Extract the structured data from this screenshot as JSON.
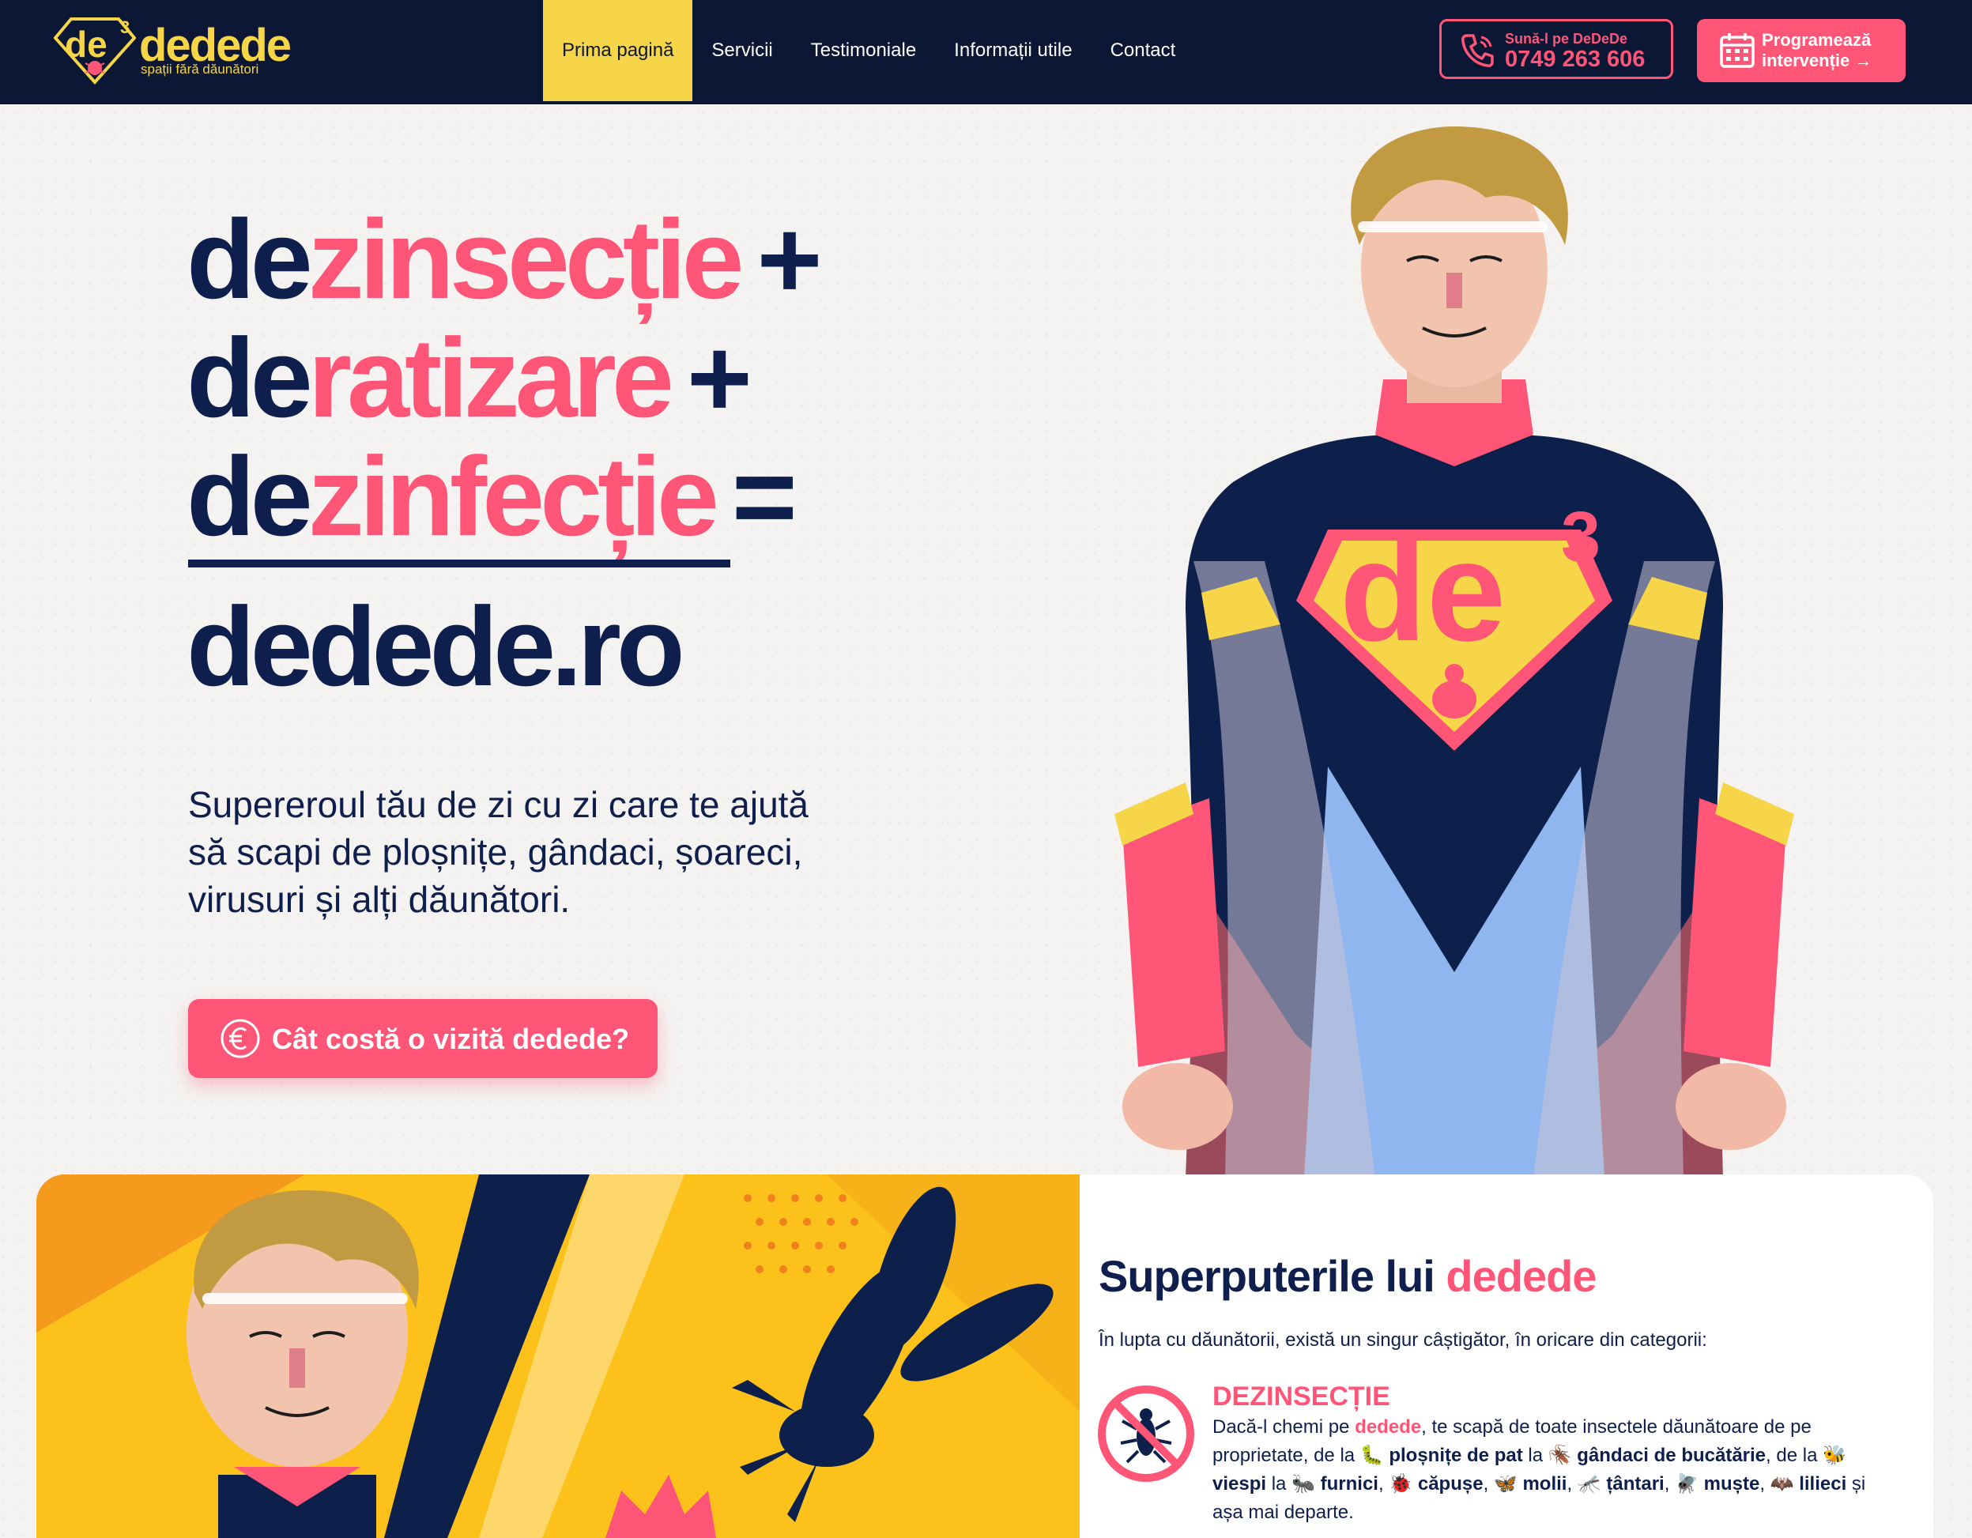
{
  "brand": {
    "logo_mark": "de",
    "logo_sup": "3",
    "name": "dedede",
    "tagline": "spații fără dăunători"
  },
  "nav": {
    "items": [
      {
        "label": "Prima pagină",
        "active": true
      },
      {
        "label": "Servicii",
        "active": false
      },
      {
        "label": "Testimoniale",
        "active": false
      },
      {
        "label": "Informații utile",
        "active": false
      },
      {
        "label": "Contact",
        "active": false
      }
    ]
  },
  "call": {
    "small": "Sună-l pe DeDeDe",
    "number": "0749 263 606",
    "icon": "phone-icon"
  },
  "book": {
    "line1": "Programează",
    "line2": "intervenție →",
    "icon": "calendar-icon"
  },
  "hero": {
    "lines": [
      {
        "prefix": "de",
        "word": "zinsecție",
        "op": "+"
      },
      {
        "prefix": "de",
        "word": "ratizare",
        "op": "+"
      },
      {
        "prefix": "de",
        "word": "zinfecție",
        "op": "="
      }
    ],
    "domain": "dedede.ro",
    "subtitle": "Supereroul tău de zi cu zi care te ajută să scapi de ploșnițe, gândaci, șoareci, virusuri și alți dăunători.",
    "cta": "Cât costă o vizită dedede?",
    "cta_icon": "euro-icon",
    "chest_mark": "de",
    "chest_sup": "3"
  },
  "powers": {
    "title_plain": "Superputerile lui ",
    "title_accent": "dedede",
    "intro": "În lupta cu dăunătorii, există un singur câștigător, în oricare din categorii:",
    "section_title": "DEZINSECȚIE",
    "section_icon": "no-insect-icon",
    "text": {
      "t1": "Dacă-l chemi pe ",
      "brand": "dedede",
      "t2": ", te scapă de toate insectele dăunătoare de pe proprietate, de la 🐛 ",
      "b1": "ploșnițe de pat",
      "t3": " la 🪳 ",
      "b2": "gândaci de bucătărie",
      "t4": ", de la 🐝 ",
      "b3": "viespi",
      "t5": " la 🐜 ",
      "b4": "furnici",
      "t6": ", 🐞 ",
      "b5": "căpușe",
      "t7": ", 🦋 ",
      "b6": "molii",
      "t8": ", 🦟 ",
      "b7": "țântari",
      "t9": ", 🪰 ",
      "b8": "muște",
      "t10": ", 🦇 ",
      "b9": "lilieci",
      "t11": " și așa mai departe."
    }
  },
  "colors": {
    "navy": "#0b1735",
    "text_navy": "#0e1f4d",
    "yellow": "#f7d548",
    "pink": "#ff5576"
  }
}
